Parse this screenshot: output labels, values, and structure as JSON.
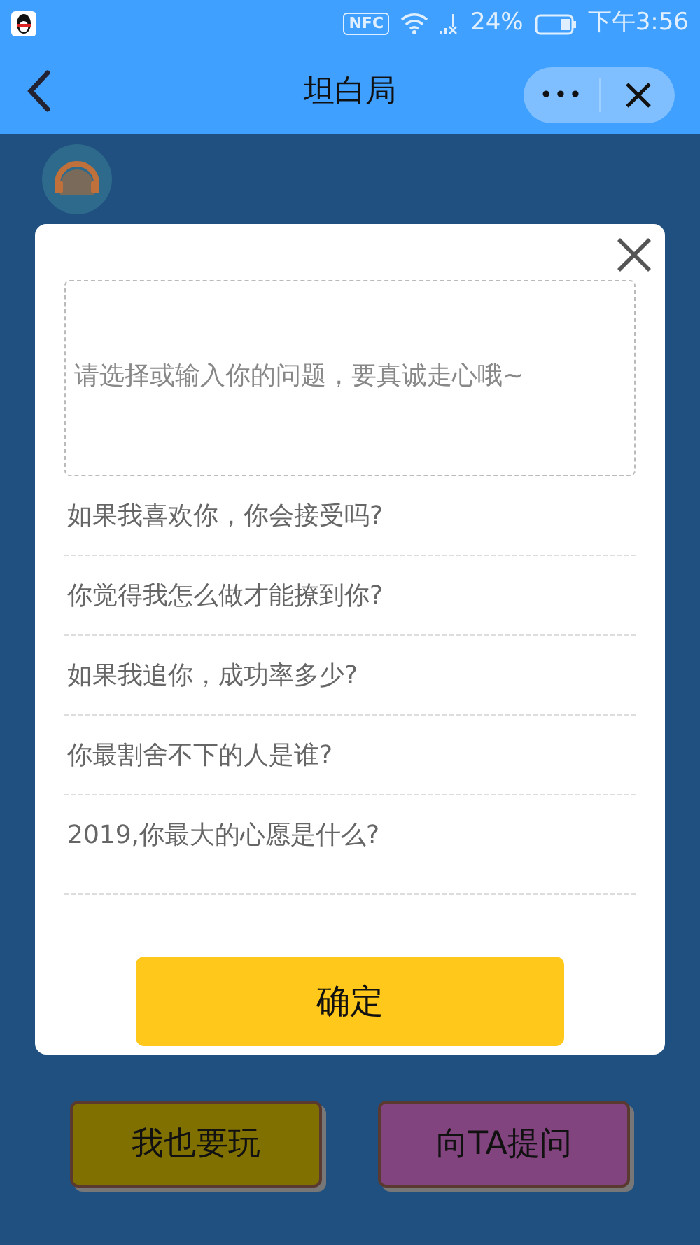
{
  "status_bar": {
    "nfc": "NFC",
    "battery": "24%",
    "time": "下午3:56"
  },
  "header": {
    "title": "坦白局",
    "more": "•••"
  },
  "dialog": {
    "question_field": {
      "placeholder": "请选择或输入你的问题，要真诚走心哦~"
    },
    "questions": [
      "如果我喜欢你，你会接受吗?",
      "你觉得我怎么做才能撩到你?",
      "如果我追你，成功率多少?",
      "你最割舍不下的人是谁?",
      "2019,你最大的心愿是什么?"
    ],
    "confirm": "确定"
  },
  "actions": [
    {
      "label": "我也要玩",
      "color": "#807000"
    },
    {
      "label": "向TA提问",
      "color": "#82447f"
    }
  ]
}
